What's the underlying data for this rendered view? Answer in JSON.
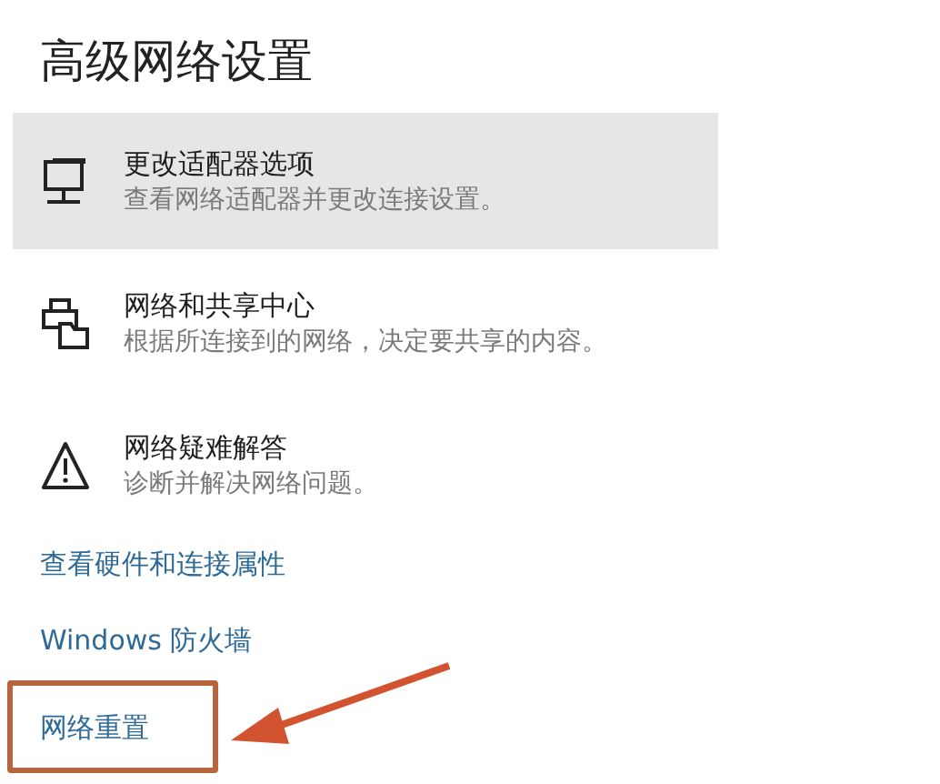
{
  "page": {
    "title": "高级网络设置"
  },
  "items": [
    {
      "kind": "adapter",
      "title": "更改适配器选项",
      "description": "查看网络适配器并更改连接设置。",
      "highlighted": true
    },
    {
      "kind": "sharing",
      "title": "网络和共享中心",
      "description": "根据所连接到的网络，决定要共享的内容。",
      "highlighted": false
    },
    {
      "kind": "troubleshoot",
      "title": "网络疑难解答",
      "description": "诊断并解决网络问题。",
      "highlighted": false
    }
  ],
  "links": [
    {
      "label": "查看硬件和连接属性",
      "marked": false
    },
    {
      "label": "Windows 防火墙",
      "marked": false
    },
    {
      "label": "网络重置",
      "marked": true
    }
  ]
}
